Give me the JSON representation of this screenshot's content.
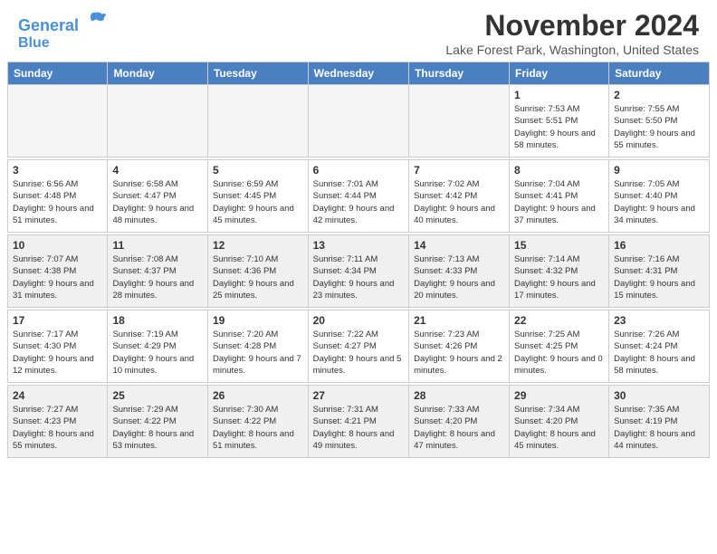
{
  "header": {
    "logo_line1": "General",
    "logo_line2": "Blue",
    "main_title": "November 2024",
    "subtitle": "Lake Forest Park, Washington, United States"
  },
  "calendar": {
    "days_of_week": [
      "Sunday",
      "Monday",
      "Tuesday",
      "Wednesday",
      "Thursday",
      "Friday",
      "Saturday"
    ],
    "weeks": [
      [
        {
          "day": "",
          "info": "",
          "empty": true
        },
        {
          "day": "",
          "info": "",
          "empty": true
        },
        {
          "day": "",
          "info": "",
          "empty": true
        },
        {
          "day": "",
          "info": "",
          "empty": true
        },
        {
          "day": "",
          "info": "",
          "empty": true
        },
        {
          "day": "1",
          "info": "Sunrise: 7:53 AM\nSunset: 5:51 PM\nDaylight: 9 hours and 58 minutes."
        },
        {
          "day": "2",
          "info": "Sunrise: 7:55 AM\nSunset: 5:50 PM\nDaylight: 9 hours and 55 minutes."
        }
      ],
      [
        {
          "day": "3",
          "info": "Sunrise: 6:56 AM\nSunset: 4:48 PM\nDaylight: 9 hours and 51 minutes."
        },
        {
          "day": "4",
          "info": "Sunrise: 6:58 AM\nSunset: 4:47 PM\nDaylight: 9 hours and 48 minutes."
        },
        {
          "day": "5",
          "info": "Sunrise: 6:59 AM\nSunset: 4:45 PM\nDaylight: 9 hours and 45 minutes."
        },
        {
          "day": "6",
          "info": "Sunrise: 7:01 AM\nSunset: 4:44 PM\nDaylight: 9 hours and 42 minutes."
        },
        {
          "day": "7",
          "info": "Sunrise: 7:02 AM\nSunset: 4:42 PM\nDaylight: 9 hours and 40 minutes."
        },
        {
          "day": "8",
          "info": "Sunrise: 7:04 AM\nSunset: 4:41 PM\nDaylight: 9 hours and 37 minutes."
        },
        {
          "day": "9",
          "info": "Sunrise: 7:05 AM\nSunset: 4:40 PM\nDaylight: 9 hours and 34 minutes."
        }
      ],
      [
        {
          "day": "10",
          "info": "Sunrise: 7:07 AM\nSunset: 4:38 PM\nDaylight: 9 hours and 31 minutes."
        },
        {
          "day": "11",
          "info": "Sunrise: 7:08 AM\nSunset: 4:37 PM\nDaylight: 9 hours and 28 minutes."
        },
        {
          "day": "12",
          "info": "Sunrise: 7:10 AM\nSunset: 4:36 PM\nDaylight: 9 hours and 25 minutes."
        },
        {
          "day": "13",
          "info": "Sunrise: 7:11 AM\nSunset: 4:34 PM\nDaylight: 9 hours and 23 minutes."
        },
        {
          "day": "14",
          "info": "Sunrise: 7:13 AM\nSunset: 4:33 PM\nDaylight: 9 hours and 20 minutes."
        },
        {
          "day": "15",
          "info": "Sunrise: 7:14 AM\nSunset: 4:32 PM\nDaylight: 9 hours and 17 minutes."
        },
        {
          "day": "16",
          "info": "Sunrise: 7:16 AM\nSunset: 4:31 PM\nDaylight: 9 hours and 15 minutes."
        }
      ],
      [
        {
          "day": "17",
          "info": "Sunrise: 7:17 AM\nSunset: 4:30 PM\nDaylight: 9 hours and 12 minutes."
        },
        {
          "day": "18",
          "info": "Sunrise: 7:19 AM\nSunset: 4:29 PM\nDaylight: 9 hours and 10 minutes."
        },
        {
          "day": "19",
          "info": "Sunrise: 7:20 AM\nSunset: 4:28 PM\nDaylight: 9 hours and 7 minutes."
        },
        {
          "day": "20",
          "info": "Sunrise: 7:22 AM\nSunset: 4:27 PM\nDaylight: 9 hours and 5 minutes."
        },
        {
          "day": "21",
          "info": "Sunrise: 7:23 AM\nSunset: 4:26 PM\nDaylight: 9 hours and 2 minutes."
        },
        {
          "day": "22",
          "info": "Sunrise: 7:25 AM\nSunset: 4:25 PM\nDaylight: 9 hours and 0 minutes."
        },
        {
          "day": "23",
          "info": "Sunrise: 7:26 AM\nSunset: 4:24 PM\nDaylight: 8 hours and 58 minutes."
        }
      ],
      [
        {
          "day": "24",
          "info": "Sunrise: 7:27 AM\nSunset: 4:23 PM\nDaylight: 8 hours and 55 minutes."
        },
        {
          "day": "25",
          "info": "Sunrise: 7:29 AM\nSunset: 4:22 PM\nDaylight: 8 hours and 53 minutes."
        },
        {
          "day": "26",
          "info": "Sunrise: 7:30 AM\nSunset: 4:22 PM\nDaylight: 8 hours and 51 minutes."
        },
        {
          "day": "27",
          "info": "Sunrise: 7:31 AM\nSunset: 4:21 PM\nDaylight: 8 hours and 49 minutes."
        },
        {
          "day": "28",
          "info": "Sunrise: 7:33 AM\nSunset: 4:20 PM\nDaylight: 8 hours and 47 minutes."
        },
        {
          "day": "29",
          "info": "Sunrise: 7:34 AM\nSunset: 4:20 PM\nDaylight: 8 hours and 45 minutes."
        },
        {
          "day": "30",
          "info": "Sunrise: 7:35 AM\nSunset: 4:19 PM\nDaylight: 8 hours and 44 minutes."
        }
      ]
    ]
  }
}
